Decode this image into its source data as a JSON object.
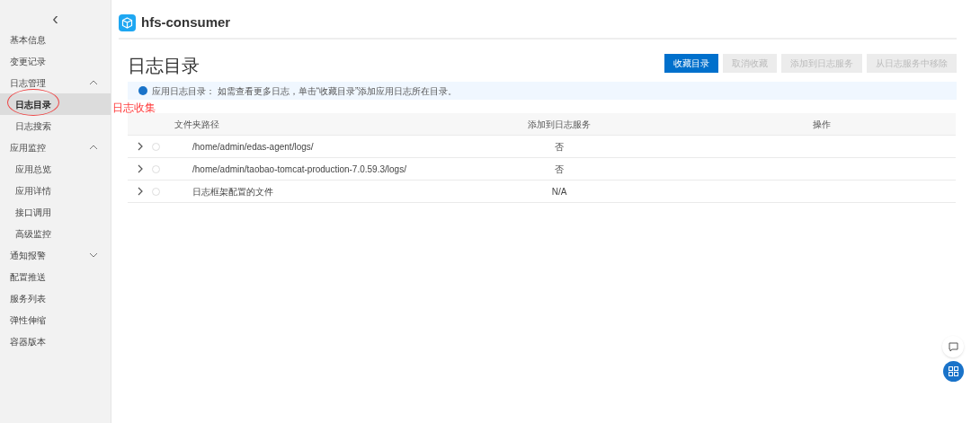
{
  "sidebar": {
    "collapse_icon": "‹",
    "items": [
      {
        "label": "基本信息",
        "selected": false
      },
      {
        "label": "变更记录",
        "selected": false
      },
      {
        "label": "日志管理",
        "expanded": true,
        "children": [
          {
            "label": "日志目录",
            "selected": true
          },
          {
            "label": "日志搜索",
            "selected": false
          }
        ]
      },
      {
        "label": "应用监控",
        "expanded": true,
        "children": [
          {
            "label": "应用总览",
            "selected": false
          },
          {
            "label": "应用详情",
            "selected": false
          },
          {
            "label": "接口调用",
            "selected": false
          },
          {
            "label": "高级监控",
            "selected": false
          }
        ]
      },
      {
        "label": "通知报警",
        "expanded": false
      },
      {
        "label": "配置推送",
        "selected": false
      },
      {
        "label": "服务列表",
        "selected": false
      },
      {
        "label": "弹性伸缩",
        "selected": false
      },
      {
        "label": "容器版本",
        "selected": false
      }
    ]
  },
  "app": {
    "name": "hfs-consumer"
  },
  "page": {
    "title": "日志目录"
  },
  "buttons": [
    {
      "label": "收藏目录",
      "disabled": false
    },
    {
      "label": "取消收藏",
      "disabled": true
    },
    {
      "label": "添加到日志服务",
      "disabled": true
    },
    {
      "label": "从日志服务中移除",
      "disabled": true
    }
  ],
  "alert": {
    "text": "应用日志目录： 如需查看更多日志，单击“收藏目录”添加应用日志所在目录。"
  },
  "annotation": {
    "text": "日志收集"
  },
  "table": {
    "columns": [
      "文件夹路径",
      "添加到日志服务",
      "操作"
    ],
    "rows": [
      {
        "path": "/home/admin/edas-agent/logs/",
        "added": "否",
        "checked": false
      },
      {
        "path": "/home/admin/taobao-tomcat-production-7.0.59.3/logs/",
        "added": "否",
        "checked": false
      },
      {
        "path": "日志框架配置的文件",
        "added": "N/A",
        "checked": false
      }
    ]
  }
}
